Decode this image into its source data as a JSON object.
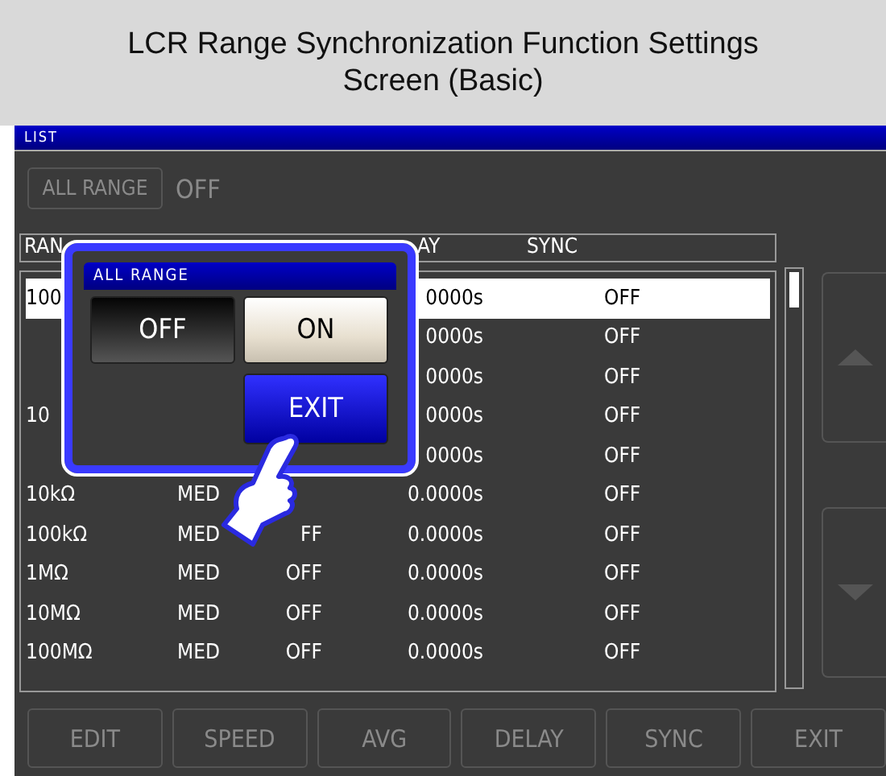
{
  "caption": "LCR Range Synchronization Function Settings Screen (Basic)",
  "title_bar": {
    "title": "LIST"
  },
  "all_range": {
    "button": "ALL RANGE",
    "disabled": true,
    "value": "OFF"
  },
  "table": {
    "header": [
      "RAN",
      "AY",
      "SYNC"
    ],
    "rows": [
      {
        "range": "100",
        "delay": "0000s",
        "sync": "OFF",
        "selected": true
      },
      {
        "delay": "0000s",
        "sync": "OFF",
        "selected": false
      },
      {
        "delay": "0000s",
        "sync": "OFF",
        "selected": false
      },
      {
        "range": "10",
        "delay": "0000s",
        "sync": "OFF",
        "selected": false
      },
      {
        "delay": "0000s",
        "sync": "OFF",
        "selected": false
      },
      {
        "range": "10kΩ",
        "speed": "MED",
        "delay": "0.0000s",
        "sync": "OFF",
        "selected": false
      },
      {
        "range": "100kΩ",
        "speed": "MED",
        "avg": "FF",
        "delay": "0.0000s",
        "sync": "OFF",
        "selected": false
      },
      {
        "range": "1MΩ",
        "speed": "MED",
        "avg": "OFF",
        "delay": "0.0000s",
        "sync": "OFF",
        "selected": false
      },
      {
        "range": "10MΩ",
        "speed": "MED",
        "avg": "OFF",
        "delay": "0.0000s",
        "sync": "OFF",
        "selected": false
      },
      {
        "range": "100MΩ",
        "speed": "MED",
        "avg": "OFF",
        "delay": "0.0000s",
        "sync": "OFF",
        "selected": false
      }
    ]
  },
  "dialog": {
    "title": "ALL RANGE",
    "options": [
      {
        "label": "OFF",
        "selected": false
      },
      {
        "label": "ON",
        "selected": true
      }
    ],
    "exit": "EXIT"
  },
  "bottom_buttons": [
    {
      "label": "EDIT",
      "disabled": true
    },
    {
      "label": "SPEED",
      "disabled": true
    },
    {
      "label": "AVG",
      "disabled": true
    },
    {
      "label": "DELAY",
      "disabled": true
    },
    {
      "label": "SYNC",
      "disabled": true
    },
    {
      "label": "EXIT",
      "disabled": true
    }
  ]
}
